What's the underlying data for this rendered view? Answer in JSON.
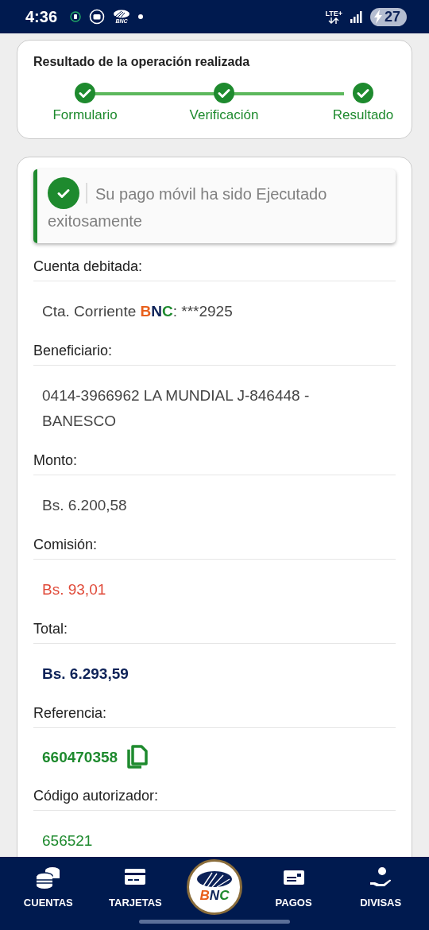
{
  "status_bar": {
    "time": "4:36",
    "app_badge": "BNC",
    "network": "LTE+",
    "battery": "27"
  },
  "progress_card": {
    "title": "Resultado de la operación realizada",
    "steps": [
      {
        "label": "Formulario",
        "done": true
      },
      {
        "label": "Verificación",
        "done": true
      },
      {
        "label": "Resultado",
        "done": true
      }
    ]
  },
  "alert": {
    "message": "Su pago móvil ha sido Ejecutado exitosamente"
  },
  "fields": [
    {
      "label": "Cuenta debitada:",
      "kind": "account",
      "prefix": "Cta. Corriente ",
      "bank": [
        {
          "text": "B",
          "color": "#e8601c"
        },
        {
          "text": "N",
          "color": "#0d2258"
        },
        {
          "text": "C",
          "color": "#1e8a2e"
        }
      ],
      "suffix": ": ***2925"
    },
    {
      "label": "Beneficiario:",
      "kind": "plain",
      "value": "0414-3966962 LA MUNDIAL J-846448 - BANESCO"
    },
    {
      "label": "Monto:",
      "kind": "plain",
      "value": "Bs. 6.200,58"
    },
    {
      "label": "Comisión:",
      "kind": "fee",
      "value": "Bs. 93,01"
    },
    {
      "label": "Total:",
      "kind": "total",
      "value": "Bs. 6.293,59"
    },
    {
      "label": "Referencia:",
      "kind": "reference",
      "value": "660470358"
    },
    {
      "label": "Código autorizador:",
      "kind": "code",
      "value": "656521"
    }
  ],
  "nav": {
    "items": [
      {
        "kind": "tab",
        "label": "CUENTAS"
      },
      {
        "kind": "tab",
        "label": "TARJETAS"
      },
      {
        "kind": "logo",
        "label": "BNC"
      },
      {
        "kind": "tab",
        "label": "PAGOS"
      },
      {
        "kind": "tab",
        "label": "DIVISAS"
      }
    ]
  }
}
